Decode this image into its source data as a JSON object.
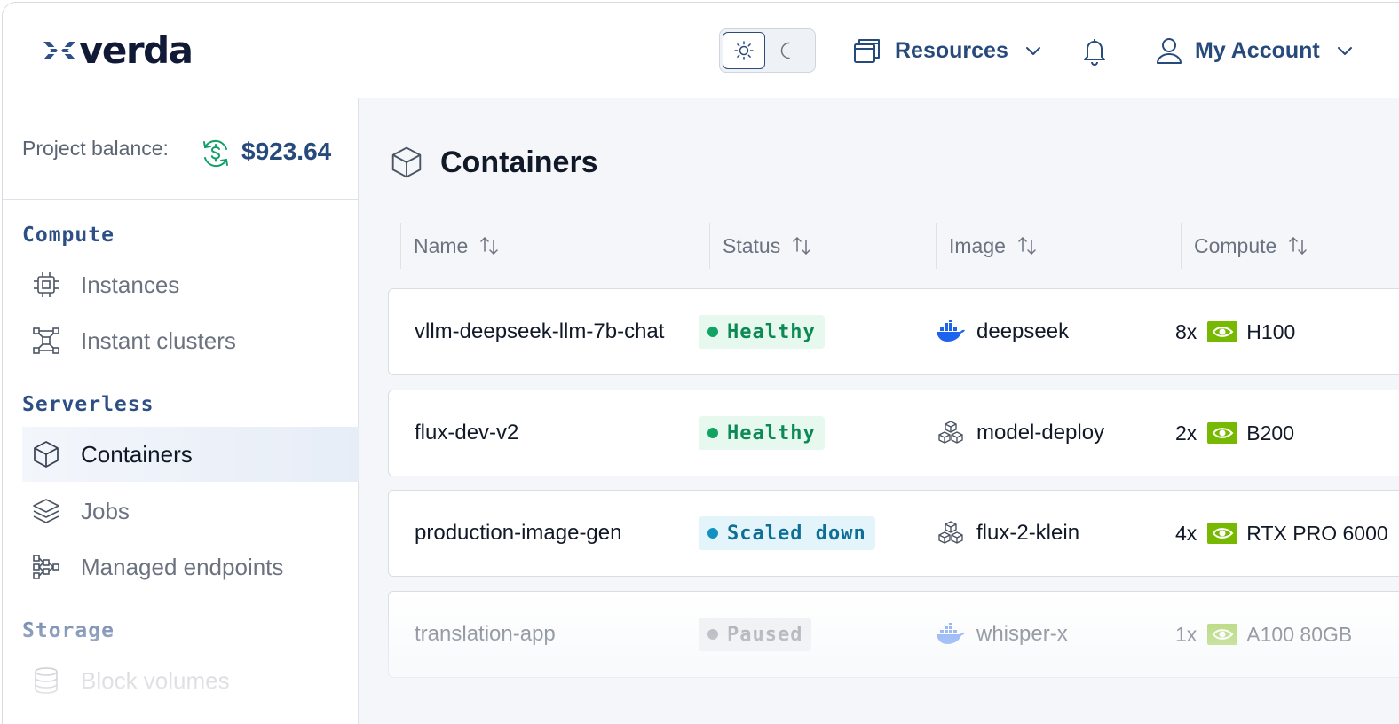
{
  "brand": {
    "name": "verda"
  },
  "header": {
    "theme_toggle": {
      "light": "sun-icon",
      "dark": "moon-icon",
      "active": "light"
    },
    "resources_label": "Resources",
    "account_label": "My Account"
  },
  "sidebar": {
    "balance_label": "Project balance:",
    "balance_value": "$923.64",
    "sections": [
      {
        "title": "Compute",
        "items": [
          {
            "label": "Instances",
            "icon": "chip-icon"
          },
          {
            "label": "Instant clusters",
            "icon": "cluster-icon"
          }
        ]
      },
      {
        "title": "Serverless",
        "items": [
          {
            "label": "Containers",
            "icon": "cube-icon",
            "active": true
          },
          {
            "label": "Jobs",
            "icon": "layers-icon"
          },
          {
            "label": "Managed endpoints",
            "icon": "endpoints-icon"
          }
        ]
      },
      {
        "title": "Storage",
        "items": [
          {
            "label": "Block volumes",
            "icon": "database-icon"
          }
        ]
      }
    ]
  },
  "main": {
    "page_title": "Containers",
    "columns": [
      "Name",
      "Status",
      "Image",
      "Compute"
    ],
    "rows": [
      {
        "name": "vllm-deepseek-llm-7b-chat",
        "status": "Healthy",
        "image_icon": "docker-icon",
        "image": "deepseek",
        "count": "8x",
        "gpu": "H100"
      },
      {
        "name": "flux-dev-v2",
        "status": "Healthy",
        "image_icon": "blocks-icon",
        "image": "model-deploy",
        "count": "2x",
        "gpu": "B200"
      },
      {
        "name": "production-image-gen",
        "status": "Scaled down",
        "image_icon": "blocks-icon",
        "image": "flux-2-klein",
        "count": "4x",
        "gpu": "RTX PRO 6000"
      },
      {
        "name": "translation-app",
        "status": "Paused",
        "image_icon": "docker-icon",
        "image": "whisper-x",
        "count": "1x",
        "gpu": "A100 80GB"
      }
    ]
  },
  "colors": {
    "accent": "#274a7c",
    "healthy": "#0b8a55",
    "scaled_down": "#0d6f95",
    "paused": "#9aa0a8",
    "nvidia": "#76b900",
    "docker": "#1d63ed"
  }
}
